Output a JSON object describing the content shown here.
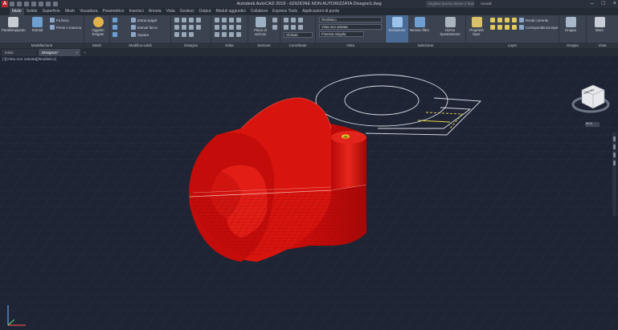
{
  "app": {
    "logo": "A",
    "title": "Autodesk AutoCAD 2019 - EDIZIONE NON AUTORIZZATA    Disegno1.dwg",
    "search_placeholder": "Digitare parola chiave o frase",
    "user": "Accedi"
  },
  "tabs": [
    "Inizio",
    "Solido",
    "Superficie",
    "Mesh",
    "Visualizza",
    "Parametrico",
    "Inserisci",
    "Annota",
    "Vista",
    "Gestisci",
    "Output",
    "Moduli aggiuntivi",
    "Collabora",
    "Express Tools",
    "Applicazioni di punta"
  ],
  "ribbon": {
    "modeling": {
      "title": "Modellazione",
      "box": "Parallelepipedo",
      "extrude": "Estrudi",
      "smooth": "Fa liscio",
      "press_pull": "Premi e trascina"
    },
    "mesh": {
      "title": "Mesh",
      "smooth": "Oggetto levigato"
    },
    "solid_edit": {
      "title": "Modifica solidi",
      "extract_edges": "Estrai spigoli",
      "extrude_faces": "Estrudi facce",
      "separate": "Separa"
    },
    "draw": {
      "title": "Disegna"
    },
    "modify": {
      "title": "Edita"
    },
    "section": {
      "title": "Sezione",
      "plane": "Piano di sezione"
    },
    "coordinates": {
      "title": "Coordinate",
      "ucs": "Globale"
    },
    "view": {
      "title": "Vista",
      "visual_style": "Realistico",
      "view_name": "Vista non salvata",
      "viewport": "Finestra singola"
    },
    "selection": {
      "title": "Selezione",
      "culling": "Esclusione",
      "no_filter": "Nessun filtro",
      "gizmo": "Gizmo Spostamento"
    },
    "layers": {
      "title": "Layer",
      "properties": "Proprietà layer",
      "make_current": "Rendi corrente",
      "match_layer": "Corrispondenza layer"
    },
    "groups": {
      "title": "Gruppo",
      "group": "Gruppo"
    },
    "view2": {
      "title": "Vista",
      "base": "Base"
    }
  },
  "file_tabs": {
    "start": "Inizio",
    "drawing": "Disegno1*"
  },
  "viewport": {
    "label": "[-][Vista non salvata][Realistico]",
    "viewcube_face": "DESTRA",
    "wcs": "WCS"
  },
  "colors": {
    "solid_red": "#d10c0c",
    "viewport_bg": "#1e2433",
    "ribbon_bg": "#3b4350"
  }
}
